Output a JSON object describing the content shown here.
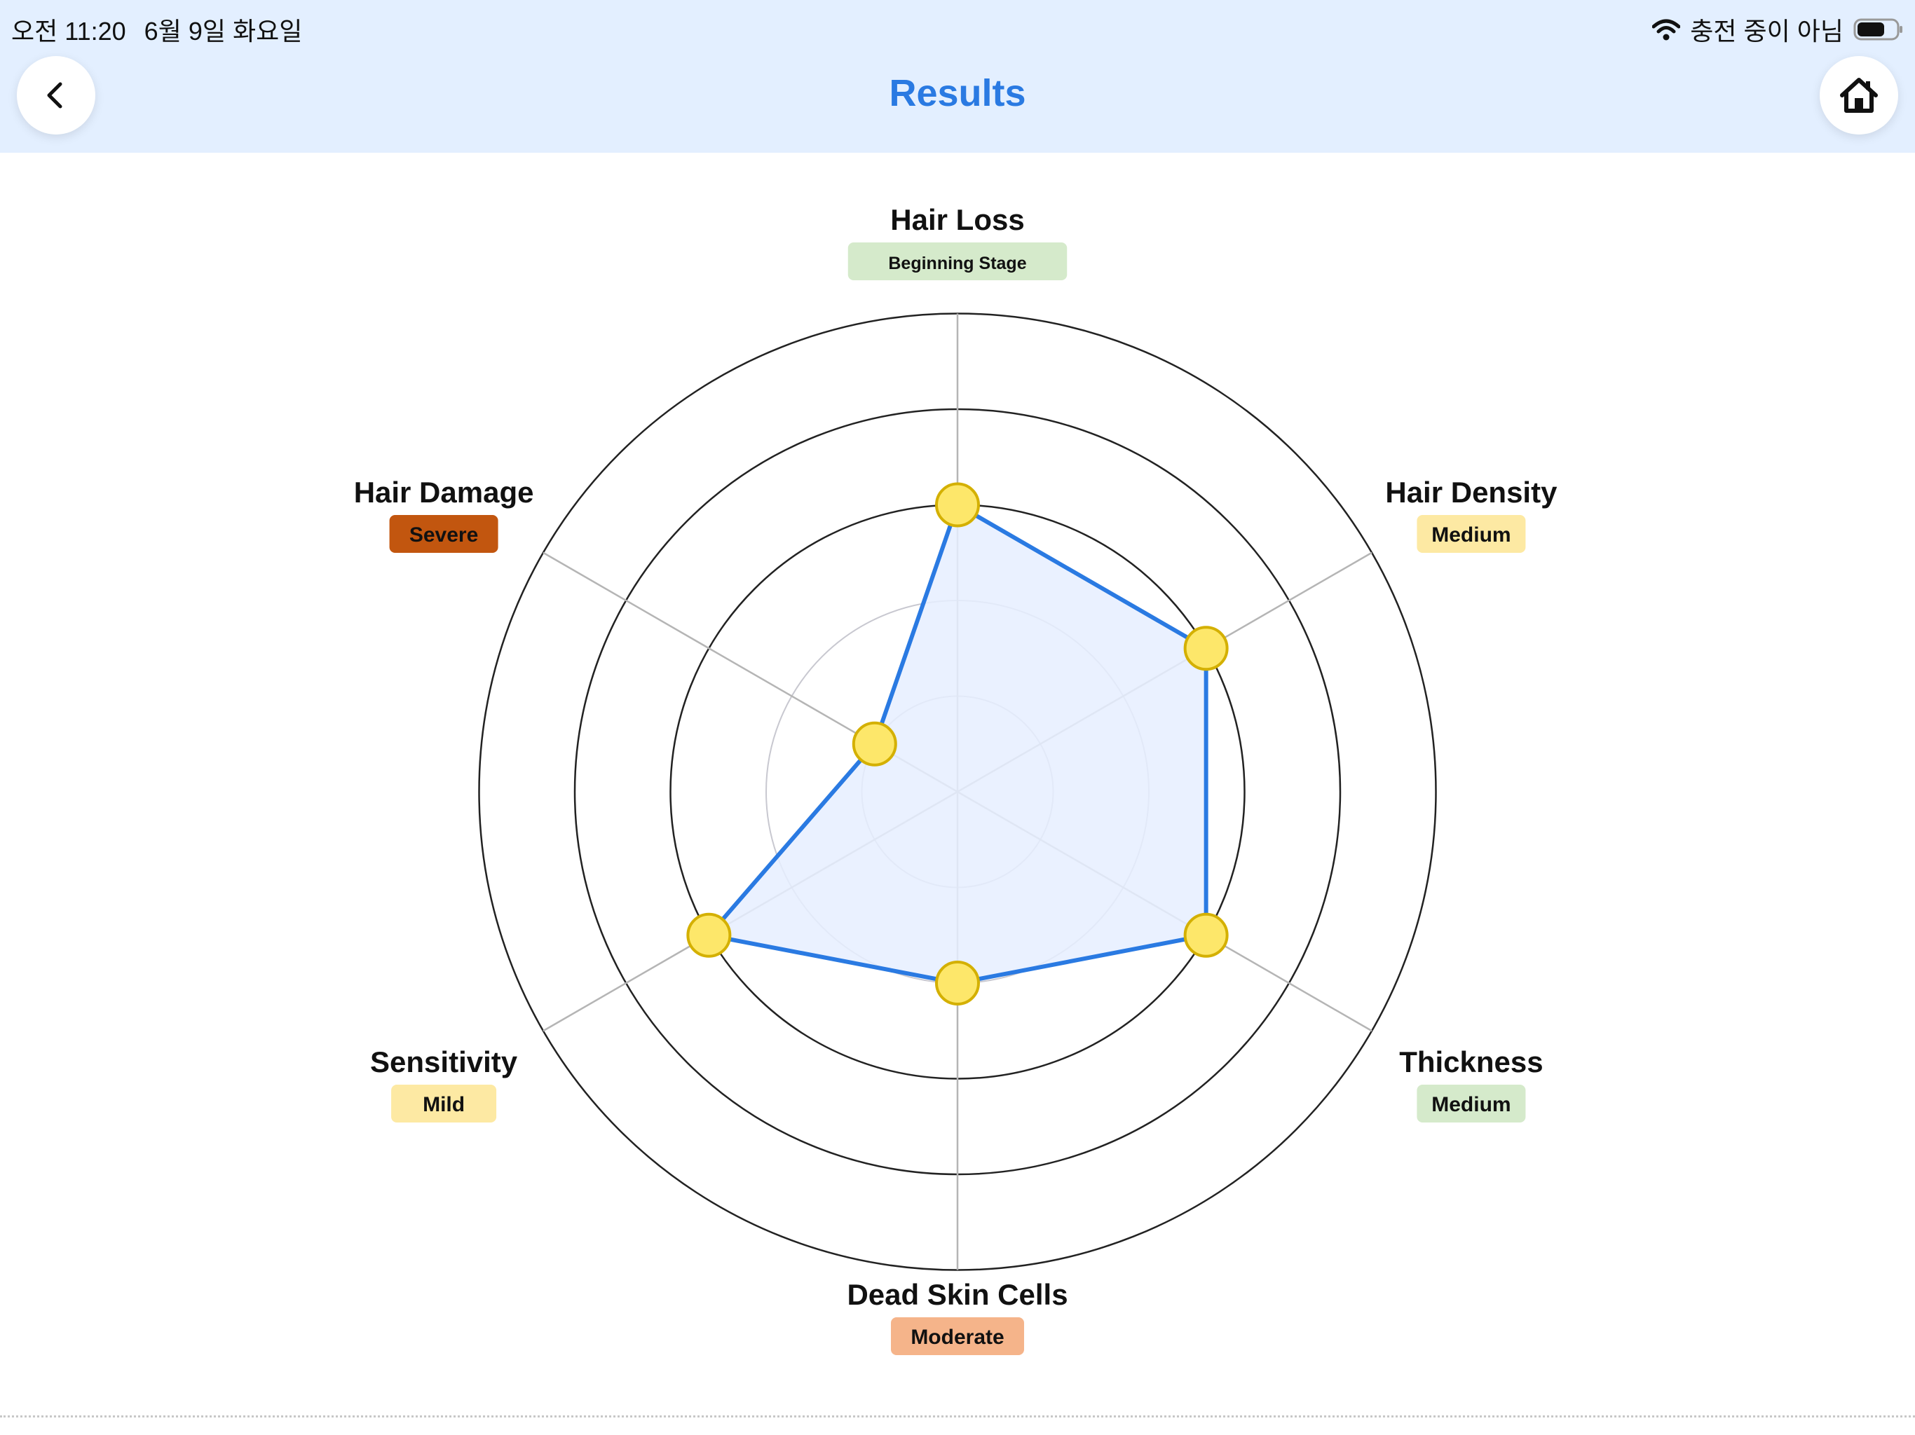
{
  "status_bar": {
    "time": "오전 11:20",
    "date": "6월 9일 화요일",
    "charging": "충전 중이 아님"
  },
  "header": {
    "title": "Results",
    "back_icon": "chevron-left-icon",
    "home_icon": "home-icon"
  },
  "colors": {
    "header_bg": "#e3efff",
    "accent": "#2a7ae2",
    "polygon_fill": "#e6efff",
    "point_fill": "#fde76a",
    "point_stroke": "#d4b000"
  },
  "chart_data": {
    "type": "radar",
    "max": 5,
    "rings": 5,
    "axes": [
      {
        "label": "Hair Loss",
        "badge": "Beginning Stage",
        "badge_bg": "#d5eacb",
        "badge_fg": "#111111",
        "value": 3
      },
      {
        "label": "Hair Density",
        "badge": "Medium",
        "badge_bg": "#fde9a3",
        "badge_fg": "#111111",
        "value": 3
      },
      {
        "label": "Thickness",
        "badge": "Medium",
        "badge_bg": "#d5eacb",
        "badge_fg": "#111111",
        "value": 3
      },
      {
        "label": "Dead Skin Cells",
        "badge": "Moderate",
        "badge_bg": "#f5b48a",
        "badge_fg": "#111111",
        "value": 2
      },
      {
        "label": "Sensitivity",
        "badge": "Mild",
        "badge_bg": "#fde9a3",
        "badge_fg": "#111111",
        "value": 3
      },
      {
        "label": "Hair Damage",
        "badge": "Severe",
        "badge_bg": "#c2560f",
        "badge_fg": "#111111",
        "value": 1
      }
    ]
  }
}
